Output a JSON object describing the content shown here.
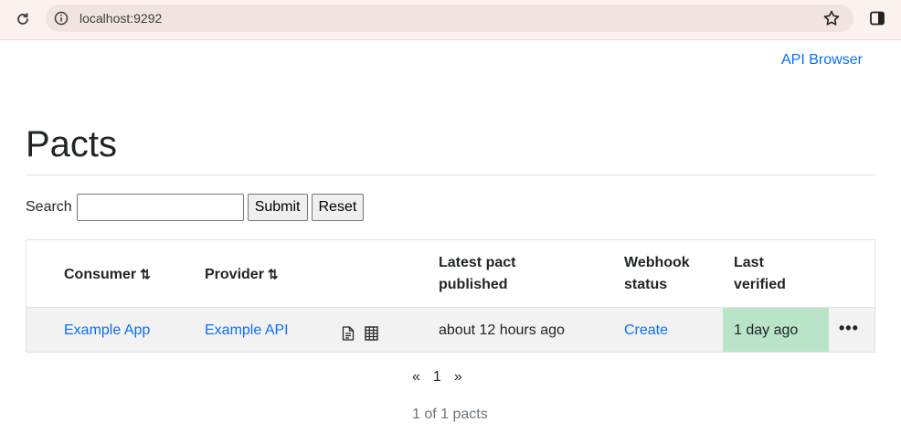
{
  "browser": {
    "url": "localhost:9292"
  },
  "header": {
    "api_browser_link": "API Browser"
  },
  "page": {
    "title": "Pacts"
  },
  "search": {
    "label": "Search",
    "value": "",
    "submit_label": "Submit",
    "reset_label": "Reset"
  },
  "table": {
    "columns": {
      "consumer": "Consumer",
      "provider": "Provider",
      "latest_pact_line1": "Latest pact",
      "latest_pact_line2": "published",
      "webhook_line1": "Webhook",
      "webhook_line2": "status",
      "last_verified_line1": "Last",
      "last_verified_line2": "verified"
    },
    "sort_icon": "⇅",
    "rows": [
      {
        "consumer": "Example App",
        "provider": "Example API",
        "doc_icon": "document-icon",
        "matrix_icon": "table-grid-icon",
        "latest_pact_published": "about 12 hours ago",
        "webhook_status": "Create",
        "last_verified": "1 day ago",
        "last_verified_color": "#b9e4c8",
        "menu": "•••"
      }
    ]
  },
  "pagination": {
    "prev": "«",
    "current": "1",
    "next": "»"
  },
  "footer": {
    "count": "1 of 1 pacts"
  },
  "colors": {
    "link": "#0d6efd",
    "chrome_bg": "#fbf1ef",
    "urlbar_bg": "#f1e3e0",
    "row_bg": "#f2f2f2"
  }
}
